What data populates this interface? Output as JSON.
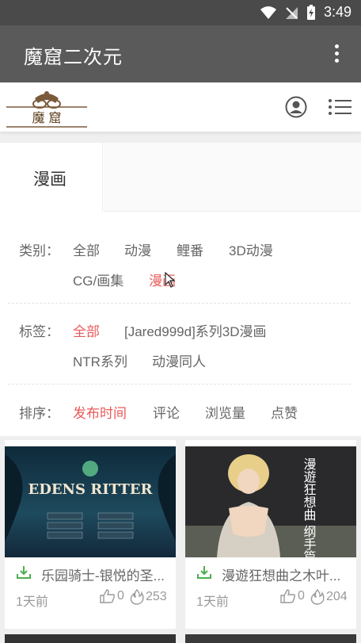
{
  "status_bar": {
    "time": "3:49"
  },
  "app_bar": {
    "title": "魔窟二次元"
  },
  "logo_text": "魔 窟",
  "tab": {
    "label": "漫画"
  },
  "filters": {
    "category": {
      "label": "类别：",
      "options": [
        "全部",
        "动漫",
        "鲤番",
        "3D动漫",
        "CG/画集",
        "漫画"
      ],
      "active_index": 5
    },
    "tag": {
      "label": "标签：",
      "options": [
        "全部",
        "[Jared999d]系列3D漫画",
        "NTR系列",
        "动漫同人"
      ],
      "active_index": 0
    },
    "sort": {
      "label": "排序：",
      "options": [
        "发布时间",
        "评论",
        "浏览量",
        "点赞"
      ],
      "active_index": 0
    }
  },
  "cards": [
    {
      "title": "乐园骑士-银悦的圣...",
      "time": "1天前",
      "likes": "0",
      "views": "253",
      "thumb_text": "EDENS RITTER"
    },
    {
      "title": "漫遊狂想曲之木叶...",
      "time": "1天前",
      "likes": "0",
      "views": "204",
      "thumb_text": "漫遊狂想曲 纲手篇"
    }
  ],
  "colors": {
    "accent": "#ea5a5a",
    "green": "#4caf50",
    "app_bar": "#5a5a5a",
    "status_bar": "#4a4a4a"
  }
}
